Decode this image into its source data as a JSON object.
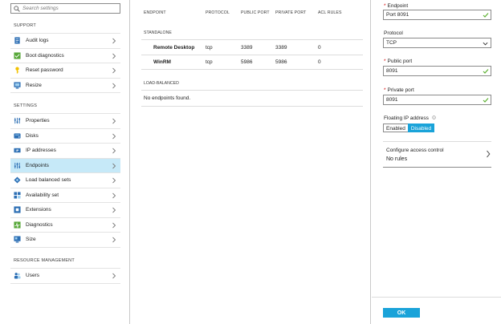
{
  "search": {
    "placeholder": "Search settings"
  },
  "sections": {
    "support": "SUPPORT",
    "settings": "SETTINGS",
    "resource_management": "RESOURCE MANAGEMENT"
  },
  "support_items": [
    {
      "label": "Audit logs",
      "icon": "audit-log-icon"
    },
    {
      "label": "Boot diagnostics",
      "icon": "boot-diagnostics-icon"
    },
    {
      "label": "Reset password",
      "icon": "key-icon"
    },
    {
      "label": "Resize",
      "icon": "resize-icon"
    }
  ],
  "settings_items": [
    {
      "label": "Properties",
      "icon": "properties-icon"
    },
    {
      "label": "Disks",
      "icon": "disk-icon"
    },
    {
      "label": "IP addresses",
      "icon": "ip-address-icon"
    },
    {
      "label": "Endpoints",
      "icon": "endpoint-icon",
      "active": true
    },
    {
      "label": "Load balanced sets",
      "icon": "load-balancer-icon"
    },
    {
      "label": "Availability set",
      "icon": "availability-set-icon"
    },
    {
      "label": "Extensions",
      "icon": "extensions-icon"
    },
    {
      "label": "Diagnostics",
      "icon": "diagnostics-icon"
    },
    {
      "label": "Size",
      "icon": "size-icon"
    }
  ],
  "rm_items": [
    {
      "label": "Users",
      "icon": "users-icon"
    }
  ],
  "table": {
    "columns": [
      "ENDPOINT",
      "PROTOCOL",
      "PUBLIC PORT",
      "PRIVATE PORT",
      "ACL RULES"
    ],
    "standalone_label": "STANDALONE",
    "standalone_rows": [
      {
        "endpoint": "Remote Desktop",
        "protocol": "tcp",
        "public_port": "3389",
        "private_port": "3389",
        "acl_rules": "0"
      },
      {
        "endpoint": "WinRM",
        "protocol": "tcp",
        "public_port": "5986",
        "private_port": "5986",
        "acl_rules": "0"
      }
    ],
    "lb_label": "LOAD-BALANCED",
    "lb_empty": "No endpoints found."
  },
  "form": {
    "endpoint_label": "Endpoint",
    "endpoint_value": "Port 8091",
    "protocol_label": "Protocol",
    "protocol_value": "TCP",
    "public_port_label": "Public port",
    "public_port_value": "8091",
    "private_port_label": "Private port",
    "private_port_value": "8091",
    "floating_ip_label": "Floating IP address",
    "floating_enabled": "Enabled",
    "floating_disabled": "Disabled",
    "access_control_label": "Configure access control",
    "access_control_value": "No rules",
    "ok_label": "OK"
  },
  "colors": {
    "accent": "#1aa3d9",
    "active_row": "#c6e9f8",
    "valid": "#5cb130",
    "required": "#d40000"
  }
}
